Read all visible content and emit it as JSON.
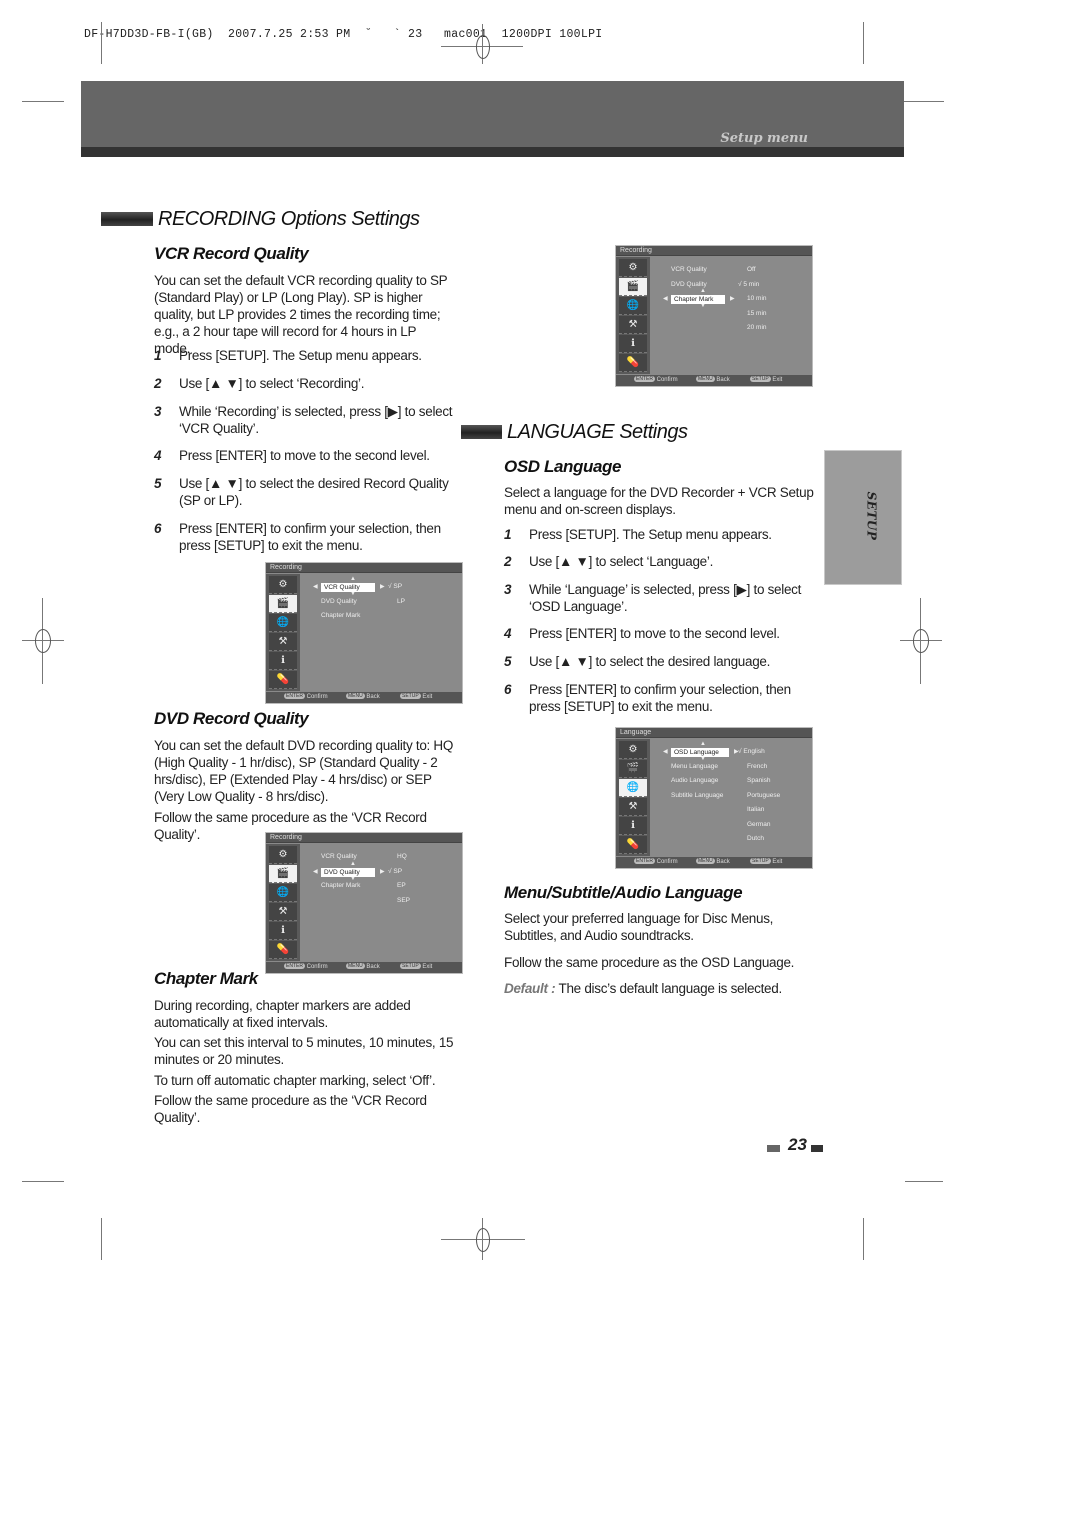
{
  "printer_line": "DF-H7DD3D-FB-I(GB)  2007.7.25 2:53 PM  ˘   ` 23   mac001  1200DPI 100LPI",
  "header": {
    "title": "Setup menu"
  },
  "side_tab": {
    "label": "SETUP"
  },
  "page_number": "23",
  "recording": {
    "section_title": "RECORDING Options Settings",
    "vcr": {
      "title": "VCR Record Quality",
      "intro": "You can set the default VCR recording quality to SP (Standard Play) or LP (Long Play). SP is higher quality, but LP provides 2 times the recording time; e.g., a 2 hour tape will record for 4 hours in LP mode.",
      "steps": [
        {
          "num": "1",
          "text": "Press [SETUP]. The Setup menu appears."
        },
        {
          "num": "2",
          "text": "Use [▲ ▼] to select ‘Recording’."
        },
        {
          "num": "3",
          "text": "While ‘Recording’ is selected, press [▶] to select ‘VCR Quality’."
        },
        {
          "num": "4",
          "text": "Press [ENTER] to move to the second level."
        },
        {
          "num": "5",
          "text": "Use [▲ ▼] to select the desired Record Quality (SP or LP)."
        },
        {
          "num": "6",
          "text": "Press [ENTER] to confirm your selection, then press [SETUP] to exit the menu."
        }
      ]
    },
    "dvd": {
      "title": "DVD Record Quality",
      "intro": "You can set the default DVD recording quality to: HQ (High Quality - 1 hr/disc), SP (Standard Quality - 2 hrs/disc), EP (Extended Play - 4 hrs/disc) or SEP (Very Low Quality - 8 hrs/disc).",
      "follow": "Follow the same procedure as the ‘VCR Record Quality’."
    },
    "chapter": {
      "title": "Chapter Mark",
      "p1": "During recording, chapter markers are added automatically at fixed intervals.",
      "p2": "You can set this interval to 5 minutes, 10 minutes, 15 minutes or 20 minutes.",
      "p3": "To turn off automatic chapter marking, select ‘Off’.",
      "p4": "Follow the same procedure as the ‘VCR Record Quality’."
    }
  },
  "language": {
    "section_title": "LANGUAGE Settings",
    "osd": {
      "title": "OSD Language",
      "intro": "Select a language for the DVD Recorder + VCR Setup menu and on-screen displays.",
      "steps": [
        {
          "num": "1",
          "text": "Press [SETUP]. The Setup menu appears."
        },
        {
          "num": "2",
          "text": "Use [▲ ▼] to select ‘Language’."
        },
        {
          "num": "3",
          "text": "While ‘Language’ is selected, press [▶] to select ‘OSD Language’."
        },
        {
          "num": "4",
          "text": "Press [ENTER] to move to the second level."
        },
        {
          "num": "5",
          "text": "Use [▲ ▼] to select the desired language."
        },
        {
          "num": "6",
          "text": "Press [ENTER] to confirm your selection, then press [SETUP] to exit the menu."
        }
      ]
    },
    "msa": {
      "title": "Menu/Subtitle/Audio Language",
      "intro": "Select your preferred language for Disc Menus, Subtitles, and Audio soundtracks.",
      "follow": "Follow the same procedure as the OSD Language.",
      "default_label": "Default :",
      "default_text": " The disc’s default language is selected."
    }
  },
  "osd_common": {
    "footer": {
      "enter_key": "ENTER",
      "enter": "Confirm",
      "menu_key": "MENU",
      "menu": "Back",
      "setup_key": "SETUP",
      "setup": "Exit"
    },
    "sidebar_icons": [
      "⚙",
      "🎬",
      "🌐",
      "⚒",
      "ℹ",
      "💊"
    ]
  },
  "screens": {
    "vcr": {
      "title": "Recording",
      "items": [
        "VCR Quality",
        "DVD Quality",
        "Chapter Mark"
      ],
      "highlighted": "VCR Quality",
      "options": [
        "√ SP",
        "LP"
      ]
    },
    "dvd": {
      "title": "Recording",
      "items": [
        "VCR Quality",
        "DVD Quality",
        "Chapter Mark"
      ],
      "highlighted": "DVD Quality",
      "options": [
        "HQ",
        "√ SP",
        "EP",
        "SEP"
      ]
    },
    "chapter": {
      "title": "Recording",
      "items": [
        "VCR Quality",
        "DVD Quality",
        "Chapter Mark"
      ],
      "highlighted": "Chapter Mark",
      "options": [
        "Off",
        "√ 5 min",
        "10 min",
        "15 min",
        "20 min"
      ]
    },
    "language": {
      "title": "Language",
      "items": [
        "OSD Language",
        "Menu Language",
        "Audio Language",
        "Subtitle Language"
      ],
      "highlighted": "OSD Language",
      "options": [
        "√ English",
        "French",
        "Spanish",
        "Portuguese",
        "Italian",
        "German",
        "Dutch"
      ]
    }
  }
}
